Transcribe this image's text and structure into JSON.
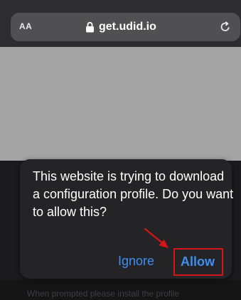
{
  "browser": {
    "text_size_label": "AA",
    "url": "get.udid.io",
    "lock_icon": "lock-icon",
    "reload_icon": "reload-icon"
  },
  "dialog": {
    "message": "This website is trying to download a configuration profile. Do you want to allow this?",
    "ignore_label": "Ignore",
    "allow_label": "Allow"
  },
  "page": {
    "install_note": "When prompted please install the profile"
  },
  "colors": {
    "accent_blue": "#3f8ef2",
    "highlight_red": "#d6141a",
    "dialog_bg": "#242426",
    "address_bar_bg": "#505053"
  }
}
